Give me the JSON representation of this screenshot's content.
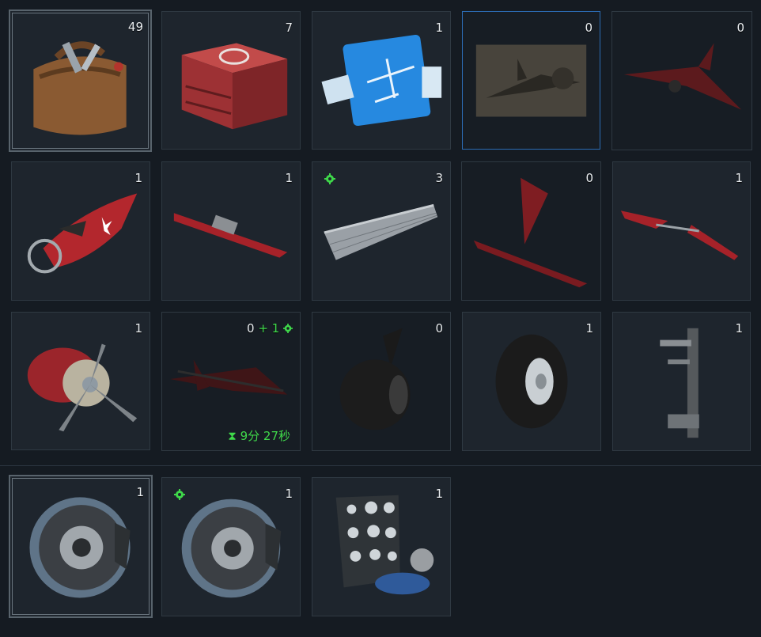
{
  "colors": {
    "background": "#151b22",
    "slot": "#1e252d",
    "accent_green": "#3fd94a",
    "selected_border": "#2c6cb4",
    "part_red": "#a8232a"
  },
  "items": [
    {
      "name": "toolbag",
      "count": "49"
    },
    {
      "name": "repair-kit-crate",
      "count": "7"
    },
    {
      "name": "blueprint",
      "count": "1"
    },
    {
      "name": "aircraft-photo",
      "count": "0"
    },
    {
      "name": "aircraft-silhouette",
      "count": "0"
    },
    {
      "name": "fuselage-nose",
      "count": "1"
    },
    {
      "name": "center-wing",
      "count": "1"
    },
    {
      "name": "wing-panel",
      "count": "3",
      "icon": "gear-icon"
    },
    {
      "name": "tail-assembly",
      "count": "0"
    },
    {
      "name": "tailplane",
      "count": "1"
    },
    {
      "name": "radial-engine",
      "count": "1"
    },
    {
      "name": "aircraft-in-progress",
      "count": "0",
      "plus": "+ 1",
      "timer": "9分 27秒"
    },
    {
      "name": "tail-wheel",
      "count": "0"
    },
    {
      "name": "main-wheel",
      "count": "1"
    },
    {
      "name": "landing-gear-strut",
      "count": "1"
    },
    {
      "name": "brake-drum",
      "count": "1"
    },
    {
      "name": "brake-drum-upgraded",
      "count": "1",
      "icon": "gear-icon"
    },
    {
      "name": "instrument-panel",
      "count": "1"
    }
  ]
}
